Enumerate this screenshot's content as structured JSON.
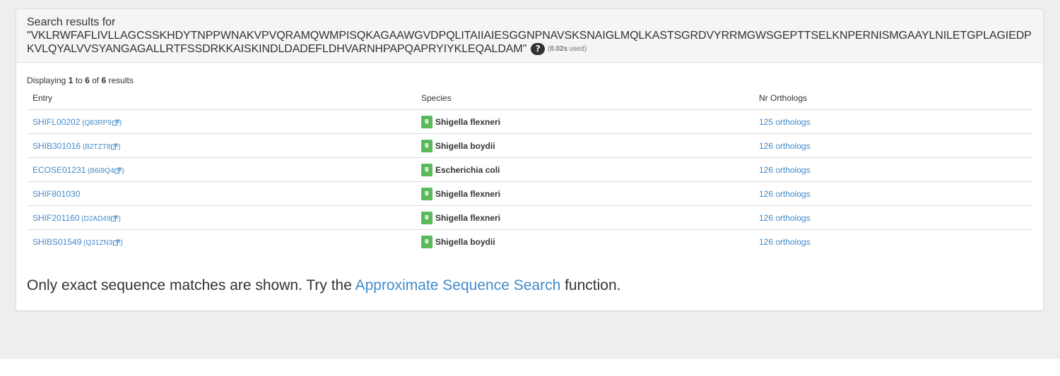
{
  "header": {
    "search_label": "Search results for",
    "query": "\"VKLRWFAFLIVLLAGCSSKHDYTNPPWNAKVPVQRAMQWMPISQKAGAAWGVDPQLITAIIAIESGGNPNAVSKSNAIGLMQLKASTSGRDVYRRMGWSGEPTTSELKNPERNISMGAAYLNILETGPLAGIEDPKVLQYALVVSYANGAGALLRTFSSDRKKAISKINDLDADEFLDHVARNHPAPQAPRYIYKLEQALDAM\"",
    "help_symbol": "?",
    "timing_open": "(",
    "timing_value": "0.02s",
    "timing_suffix": " used)"
  },
  "results": {
    "displaying_prefix": "Displaying ",
    "from": "1",
    "to_word": " to ",
    "to": "6",
    "of_word": " of ",
    "total": "6",
    "suffix": " results",
    "columns": [
      "Entry",
      "Species",
      "Nr Orthologs"
    ],
    "rows": [
      {
        "entry": "SHIFL00202",
        "xref": "Q83RP9",
        "species": "Shigella flexneri",
        "orthologs": "125 orthologs"
      },
      {
        "entry": "SHIB301016",
        "xref": "B2TZT8",
        "species": "Shigella boydii",
        "orthologs": "126 orthologs"
      },
      {
        "entry": "ECOSE01231",
        "xref": "B6I9Q4",
        "species": "Escherichia coli",
        "orthologs": "126 orthologs"
      },
      {
        "entry": "SHIF801030",
        "xref": "",
        "species": "Shigella flexneri",
        "orthologs": "126 orthologs"
      },
      {
        "entry": "SHIF201160",
        "xref": "D2AD49",
        "species": "Shigella flexneri",
        "orthologs": "126 orthologs"
      },
      {
        "entry": "SHIBS01549",
        "xref": "Q31ZN3",
        "species": "Shigella boydii",
        "orthologs": "126 orthologs"
      }
    ],
    "species_badge": "B"
  },
  "footer": {
    "note_prefix": "Only exact sequence matches are shown. Try the ",
    "link_text": "Approximate Sequence Search",
    "note_suffix": "  function."
  },
  "colors": {
    "link": "#428bca",
    "badge_green": "#5cb85c",
    "panel_heading_bg": "#f5f5f5",
    "page_bg": "#eeeeee"
  },
  "icons": {
    "external_link": "external-link-icon",
    "species_domain": "bacteria-badge-icon",
    "help": "question-icon"
  }
}
